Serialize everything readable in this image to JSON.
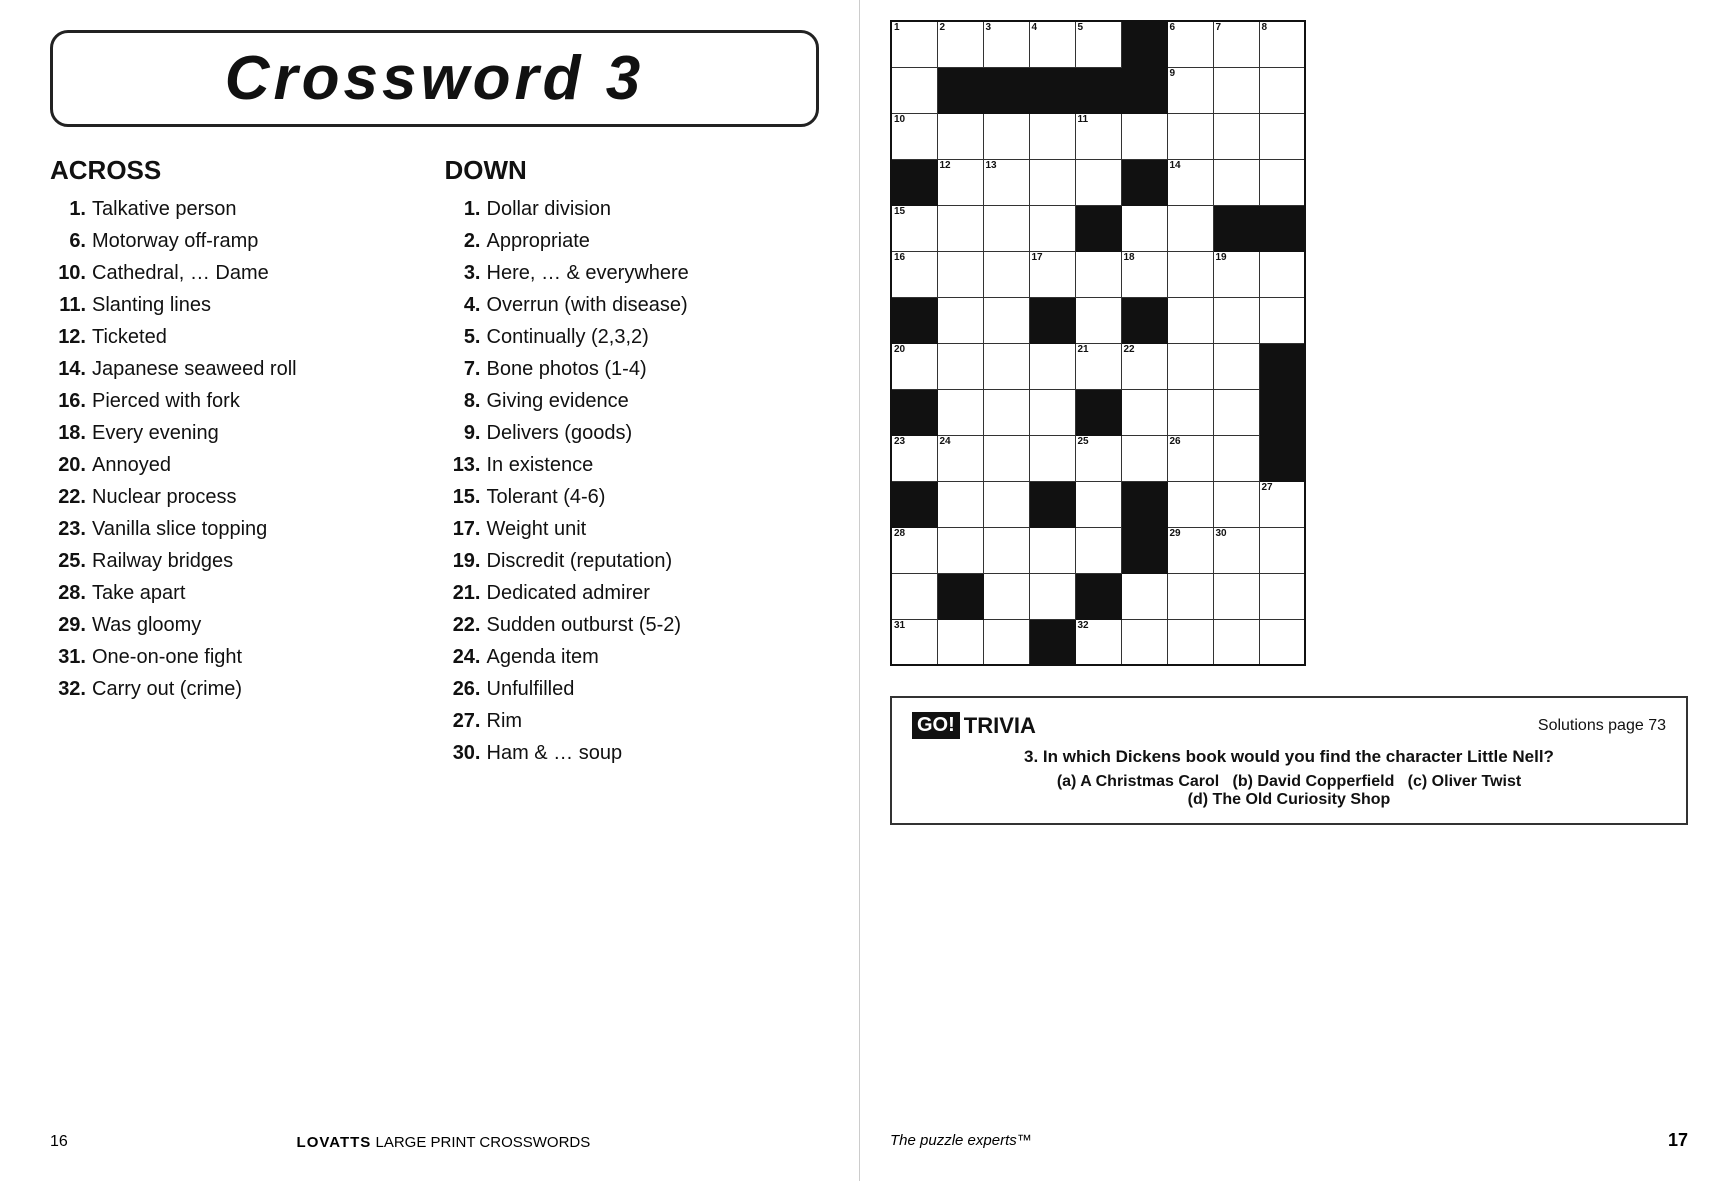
{
  "title": "Crossword   3",
  "across": {
    "heading": "ACROSS",
    "clues": [
      {
        "num": "1.",
        "text": "Talkative person"
      },
      {
        "num": "6.",
        "text": "Motorway off-ramp"
      },
      {
        "num": "10.",
        "text": "Cathedral, … Dame"
      },
      {
        "num": "11.",
        "text": "Slanting lines"
      },
      {
        "num": "12.",
        "text": "Ticketed"
      },
      {
        "num": "14.",
        "text": "Japanese seaweed roll"
      },
      {
        "num": "16.",
        "text": "Pierced with fork"
      },
      {
        "num": "18.",
        "text": "Every evening"
      },
      {
        "num": "20.",
        "text": "Annoyed"
      },
      {
        "num": "22.",
        "text": "Nuclear process"
      },
      {
        "num": "23.",
        "text": "Vanilla slice topping"
      },
      {
        "num": "25.",
        "text": "Railway bridges"
      },
      {
        "num": "28.",
        "text": "Take apart"
      },
      {
        "num": "29.",
        "text": "Was gloomy"
      },
      {
        "num": "31.",
        "text": "One-on-one fight"
      },
      {
        "num": "32.",
        "text": "Carry out (crime)"
      }
    ]
  },
  "down": {
    "heading": "DOWN",
    "clues": [
      {
        "num": "1.",
        "text": "Dollar division"
      },
      {
        "num": "2.",
        "text": "Appropriate"
      },
      {
        "num": "3.",
        "text": "Here, … & everywhere"
      },
      {
        "num": "4.",
        "text": "Overrun (with disease)"
      },
      {
        "num": "5.",
        "text": "Continually (2,3,2)"
      },
      {
        "num": "7.",
        "text": "Bone photos (1-4)"
      },
      {
        "num": "8.",
        "text": "Giving evidence"
      },
      {
        "num": "9.",
        "text": "Delivers (goods)"
      },
      {
        "num": "13.",
        "text": "In existence"
      },
      {
        "num": "15.",
        "text": "Tolerant (4-6)"
      },
      {
        "num": "17.",
        "text": "Weight unit"
      },
      {
        "num": "19.",
        "text": "Discredit (reputation)"
      },
      {
        "num": "21.",
        "text": "Dedicated admirer"
      },
      {
        "num": "22.",
        "text": "Sudden outburst (5-2)"
      },
      {
        "num": "24.",
        "text": "Agenda item"
      },
      {
        "num": "26.",
        "text": "Unfulfilled"
      },
      {
        "num": "27.",
        "text": "Rim"
      },
      {
        "num": "30.",
        "text": "Ham & … soup"
      }
    ]
  },
  "footer_left": {
    "page": "16",
    "brand": "LOVATTS",
    "subtitle": "LARGE PRINT CROSSWORDS"
  },
  "footer_right": {
    "page": "17",
    "puzzle_experts": "The puzzle experts™"
  },
  "trivia": {
    "solutions": "Solutions page 73",
    "question": "3. In which Dickens book would you find the character Little Nell?",
    "answer": "(a) A Christmas Carol  (b) David Copperfield  (c) Oliver Twist\n(d) The Old Curiosity Shop"
  }
}
